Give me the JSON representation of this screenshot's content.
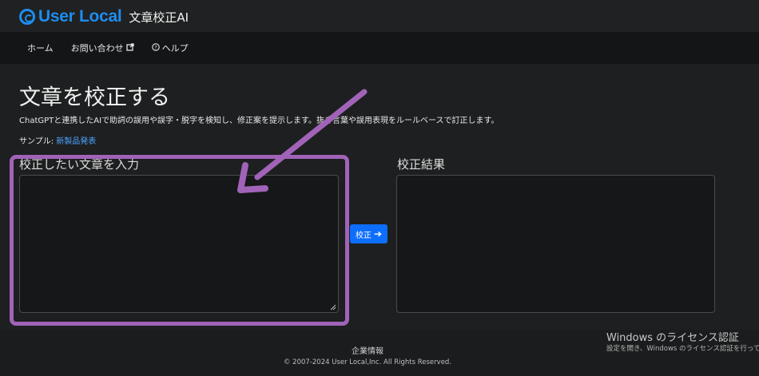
{
  "header": {
    "logo_text": "User Local",
    "app_name": "文章校正AI"
  },
  "nav": {
    "items": [
      {
        "label": "ホーム"
      },
      {
        "label": "お問い合わせ",
        "icon": "external-link-icon"
      },
      {
        "label": "ヘルプ",
        "icon": "question-circle-icon"
      }
    ]
  },
  "main": {
    "title": "文章を校正する",
    "description": "ChatGPTと連携したAIで助詞の誤用や誤字・脱字を検知し、修正案を提示します。抜き言葉や誤用表現をルールベースで訂正します。",
    "sample_label": "サンプル:",
    "sample_link": "新製品発表",
    "input_label": "校正したい文章を入力",
    "input_value": "",
    "result_label": "校正結果",
    "proof_button": "校正"
  },
  "footer": {
    "company_link": "企業情報",
    "copyright": "© 2007-2024 User Local,Inc. All Rights Reserved."
  },
  "windows_activation": {
    "title": "Windows のライセンス認証",
    "subtitle": "設定を開き、Windows のライセンス認証を行って"
  },
  "colors": {
    "accent": "#1d8df0",
    "button": "#0d6efd",
    "annotation": "#a063b8"
  }
}
